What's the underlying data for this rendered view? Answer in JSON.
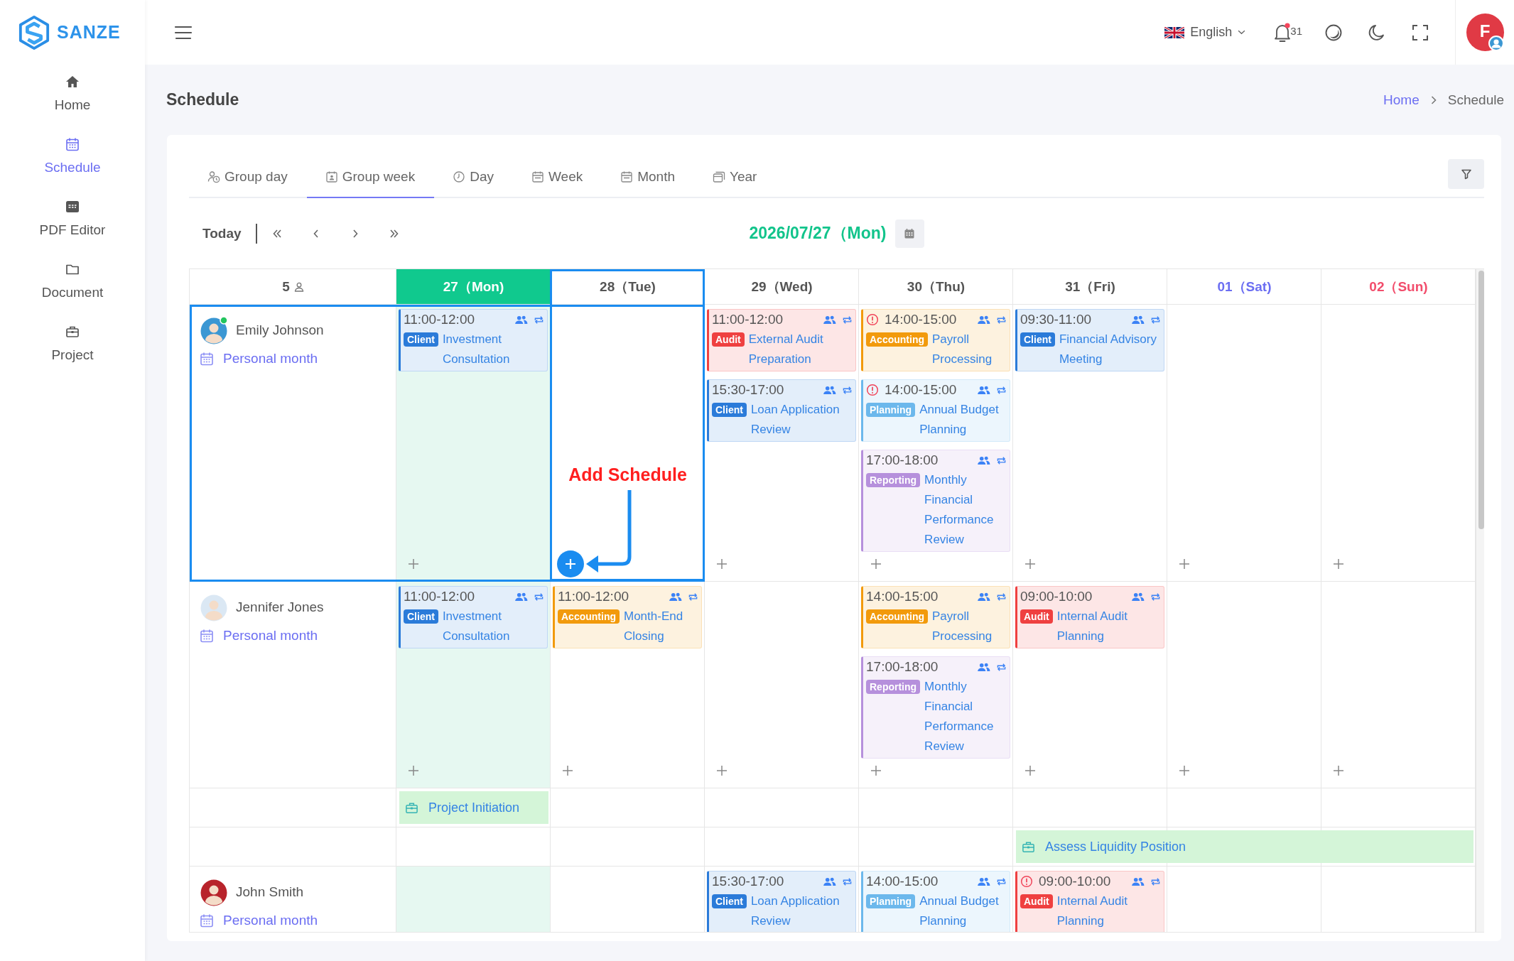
{
  "sidebar": {
    "logo": "SANZE",
    "items": [
      {
        "kind": "home",
        "label": "Home",
        "selected": false
      },
      {
        "kind": "schedule",
        "label": "Schedule",
        "selected": true
      },
      {
        "kind": "pdf",
        "label": "PDF Editor",
        "selected": false
      },
      {
        "kind": "document",
        "label": "Document",
        "selected": false
      },
      {
        "kind": "project",
        "label": "Project",
        "selected": false
      }
    ]
  },
  "header": {
    "language": "English",
    "notification_count": "31",
    "user_initial": "F"
  },
  "page": {
    "title": "Schedule",
    "breadcrumb": [
      "Home",
      "Schedule"
    ]
  },
  "tabs": [
    {
      "kind": "group_day",
      "label": "Group day",
      "selected": false
    },
    {
      "kind": "group_week",
      "label": "Group week",
      "selected": true
    },
    {
      "kind": "day",
      "label": "Day",
      "selected": false
    },
    {
      "kind": "week",
      "label": "Week",
      "selected": false
    },
    {
      "kind": "month",
      "label": "Month",
      "selected": false
    },
    {
      "kind": "year",
      "label": "Year",
      "selected": false
    }
  ],
  "toolbar": {
    "today": "Today",
    "date": "2026/07/27（Mon)"
  },
  "calendar": {
    "people_count": "5",
    "days": [
      {
        "label": "27（Mon)",
        "kind": "today"
      },
      {
        "label": "28（Tue)",
        "kind": "weekday"
      },
      {
        "label": "29（Wed)",
        "kind": "weekday"
      },
      {
        "label": "30（Thu)",
        "kind": "weekday"
      },
      {
        "label": "31（Fri)",
        "kind": "weekday"
      },
      {
        "label": "01（Sat)",
        "kind": "saturday"
      },
      {
        "label": "02（Sun)",
        "kind": "sunday"
      }
    ],
    "people": [
      {
        "name": "Emily Johnson",
        "link": "Personal month",
        "online": true,
        "avatar": {
          "color": "#3b97d3"
        },
        "cells": [
          {
            "events": [
              {
                "time": "11:00-12:00",
                "alert": false,
                "tag": {
                  "label": "Client",
                  "color": "#2b7bd9"
                },
                "title": "Investment Consultation"
              }
            ],
            "add_button": {
              "hovered": false
            }
          },
          {
            "add_button": {
              "hovered": true
            }
          },
          {
            "events": [
              {
                "time": "11:00-12:00",
                "alert": false,
                "tag": {
                  "label": "Audit",
                  "color": "#ef4040"
                },
                "title": "External Audit Preparation"
              },
              {
                "time": "15:30-17:00",
                "alert": false,
                "tag": {
                  "label": "Client",
                  "color": "#2b7bd9"
                },
                "title": "Loan Application Review"
              }
            ],
            "add_button": {
              "hovered": false
            }
          },
          {
            "events": [
              {
                "time": "14:00-15:00",
                "alert": true,
                "tag": {
                  "label": "Accounting",
                  "color": "#f29a0c"
                },
                "title": "Payroll Processing"
              },
              {
                "time": "14:00-15:00",
                "alert": true,
                "tag": {
                  "label": "Planning",
                  "color": "#6cb8ec"
                },
                "title": "Annual Budget Planning"
              },
              {
                "time": "17:00-18:00",
                "alert": false,
                "tag": {
                  "label": "Reporting",
                  "color": "#b690dc"
                },
                "title": "Monthly Financial Performance Review"
              }
            ],
            "add_button": {
              "hovered": false
            }
          },
          {
            "events": [
              {
                "time": "09:30-11:00",
                "alert": false,
                "tag": {
                  "label": "Client",
                  "color": "#2b7bd9"
                },
                "title": "Financial Advisory Meeting"
              }
            ],
            "add_button": {
              "hovered": false
            }
          },
          {
            "add_button": {
              "hovered": false
            }
          },
          {
            "add_button": {
              "hovered": false
            }
          }
        ]
      },
      {
        "name": "Jennifer Jones",
        "link": "Personal month",
        "online": false,
        "avatar": {
          "color": "#dbe8f4"
        },
        "cells": [
          {
            "events": [
              {
                "time": "11:00-12:00",
                "alert": false,
                "tag": {
                  "label": "Client",
                  "color": "#2b7bd9"
                },
                "title": "Investment Consultation"
              }
            ],
            "add_button": {
              "hovered": false
            }
          },
          {
            "events": [
              {
                "time": "11:00-12:00",
                "alert": false,
                "tag": {
                  "label": "Accounting",
                  "color": "#f29a0c"
                },
                "title": "Month-End Closing"
              }
            ],
            "add_button": {
              "hovered": false
            }
          },
          {
            "add_button": {
              "hovered": false
            }
          },
          {
            "events": [
              {
                "time": "14:00-15:00",
                "alert": false,
                "tag": {
                  "label": "Accounting",
                  "color": "#f29a0c"
                },
                "title": "Payroll Processing"
              },
              {
                "time": "17:00-18:00",
                "alert": false,
                "tag": {
                  "label": "Reporting",
                  "color": "#b690dc"
                },
                "title": "Monthly Financial Performance Review"
              }
            ],
            "add_button": {
              "hovered": false
            }
          },
          {
            "events": [
              {
                "time": "09:00-10:00",
                "alert": false,
                "tag": {
                  "label": "Audit",
                  "color": "#ef4040"
                },
                "title": "Internal Audit Planning"
              }
            ],
            "add_button": {
              "hovered": false
            }
          },
          {
            "add_button": {
              "hovered": false
            }
          },
          {
            "add_button": {
              "hovered": false
            }
          }
        ],
        "lanes": [
          {
            "slots": [
              {
                "kind": "bar",
                "name": "Project Initiation"
              },
              {
                "kind": "empty"
              },
              {
                "kind": "empty"
              },
              {
                "kind": "empty"
              },
              {
                "kind": "empty"
              },
              {
                "kind": "empty"
              },
              {
                "kind": "empty"
              }
            ]
          },
          {
            "slots": [
              {
                "kind": "empty"
              },
              {
                "kind": "empty"
              },
              {
                "kind": "empty"
              },
              {
                "kind": "empty"
              },
              {
                "kind": "bar",
                "name": "Assess Liquidity Position"
              },
              {
                "kind": "continued"
              },
              {
                "kind": "continued"
              }
            ]
          }
        ]
      },
      {
        "name": "John Smith",
        "link": "Personal month",
        "online": false,
        "avatar": {
          "color": "#b8232b"
        },
        "cells": [
          {},
          {},
          {
            "events": [
              {
                "time": "15:30-17:00",
                "alert": false,
                "tag": {
                  "label": "Client",
                  "color": "#2b7bd9"
                },
                "title": "Loan Application Review"
              }
            ]
          },
          {
            "events": [
              {
                "time": "14:00-15:00",
                "alert": false,
                "tag": {
                  "label": "Planning",
                  "color": "#6cb8ec"
                },
                "title": "Annual Budget Planning"
              }
            ]
          },
          {
            "events": [
              {
                "time": "09:00-10:00",
                "alert": true,
                "tag": {
                  "label": "Audit",
                  "color": "#ef4040"
                },
                "title": "Internal Audit Planning"
              }
            ]
          },
          {},
          {}
        ]
      }
    ]
  },
  "annotation": {
    "label": "Add Schedule"
  }
}
